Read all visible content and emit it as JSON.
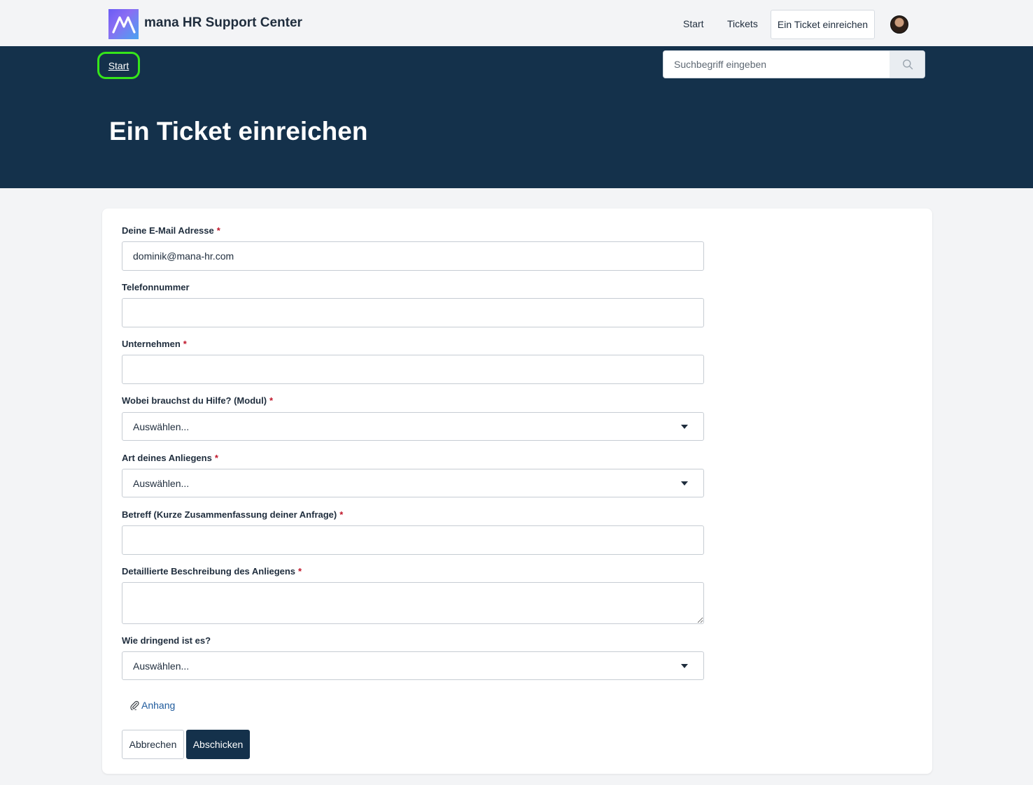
{
  "header": {
    "brand": "mana HR Support Center",
    "nav": {
      "start": "Start",
      "tickets": "Tickets",
      "submit_ticket": "Ein Ticket einreichen"
    }
  },
  "hero": {
    "breadcrumb": "Start",
    "search_placeholder": "Suchbegriff eingeben",
    "title": "Ein Ticket einreichen"
  },
  "form": {
    "email": {
      "label": "Deine E-Mail Adresse",
      "required": "*",
      "value": "dominik@mana-hr.com"
    },
    "phone": {
      "label": "Telefonnummer",
      "value": ""
    },
    "company": {
      "label": "Unternehmen",
      "required": "*",
      "value": ""
    },
    "module": {
      "label": "Wobei brauchst du Hilfe? (Modul)",
      "required": "*",
      "selected": "Auswählen..."
    },
    "type": {
      "label": "Art deines Anliegens",
      "required": "*",
      "selected": "Auswählen..."
    },
    "subject": {
      "label": "Betreff (Kurze Zusammenfassung deiner Anfrage)",
      "required": "*",
      "value": ""
    },
    "description": {
      "label": "Detaillierte Beschreibung des Anliegens",
      "required": "*",
      "value": ""
    },
    "urgency": {
      "label": "Wie dringend ist es?",
      "selected": "Auswählen..."
    },
    "attachment": "Anhang",
    "cancel": "Abbrechen",
    "submit": "Abschicken"
  },
  "colors": {
    "hero_bg": "#14314b",
    "highlight": "#35e51a",
    "required": "#c0162a",
    "link": "#1e5a9c"
  }
}
